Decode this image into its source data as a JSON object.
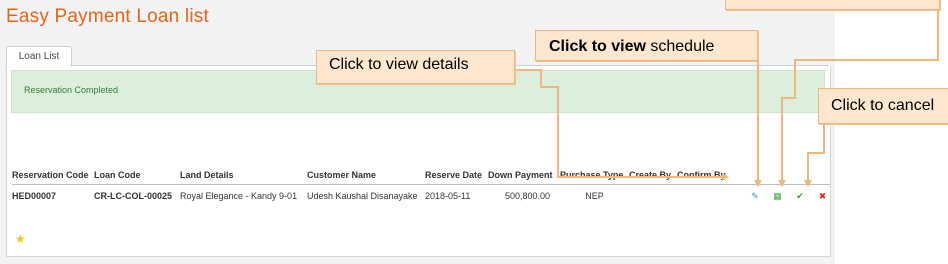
{
  "page": {
    "title": "Easy Payment Loan list"
  },
  "tabs": [
    {
      "label": "Loan List"
    }
  ],
  "alert": {
    "message": "Reservation Completed"
  },
  "table": {
    "headers": [
      "Reservation Code",
      "Loan Code",
      "Land Details",
      "Customer Name",
      "Reserve Date",
      "Down Payment",
      "Purchase Type",
      "Create By",
      "Confirm By"
    ],
    "rows": [
      {
        "reservation_code": "HED00007",
        "loan_code": "CR-LC-COL-00025",
        "land_details": "Royal Elegance - Kandy  9-01",
        "customer_name": "Udesh Kaushal Disanayake",
        "reserve_date": "2018-05-11",
        "down_payment": "500,800.00",
        "purchase_type": "NEP",
        "create_by": "",
        "confirm_by": ""
      }
    ],
    "actions": [
      {
        "name": "edit-details-icon",
        "glyph": "✎",
        "color": "#3b8fd6"
      },
      {
        "name": "schedule-calendar-icon",
        "glyph": "▦",
        "color": "#49a54a"
      },
      {
        "name": "confirm-check-icon",
        "glyph": "✔",
        "color": "#2e9b2e"
      },
      {
        "name": "cancel-x-icon",
        "glyph": "✖",
        "color": "#d9302a"
      }
    ]
  },
  "callouts": {
    "view_details": "Click to view details",
    "view_schedule_bold": "Click to view",
    "view_schedule_rest": "schedule",
    "cancel": "Click to cancel"
  },
  "colors": {
    "title": "#e8641a",
    "callout_fill": "#fde7cf",
    "callout_line": "#f2b57b",
    "alert_bg": "#dcefdc",
    "link_green": "#2e9b2e"
  }
}
